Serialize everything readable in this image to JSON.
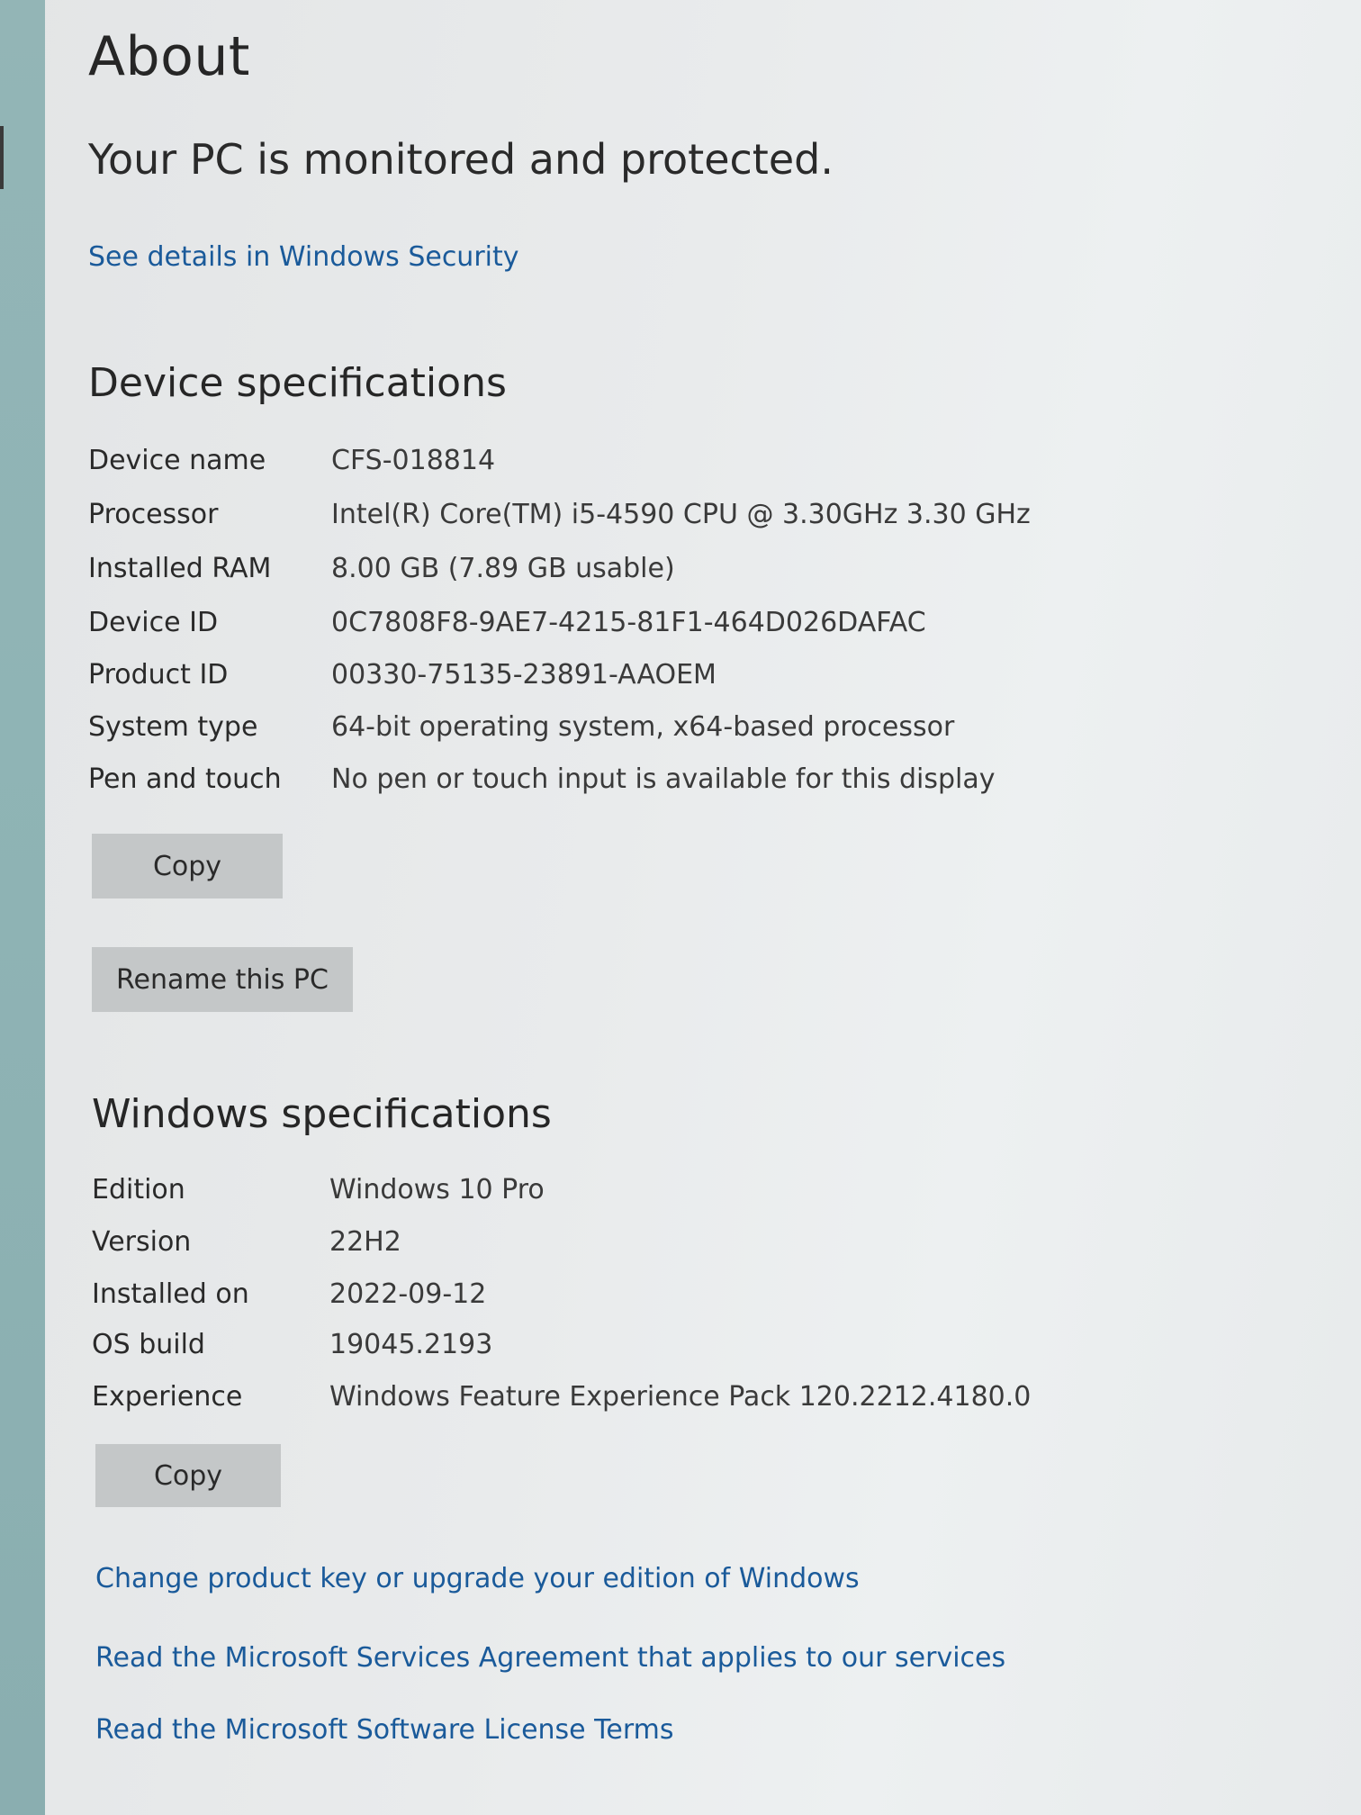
{
  "page": {
    "title": "About"
  },
  "security": {
    "status_text": "Your PC is monitored and protected.",
    "details_link": "See details in Windows Security"
  },
  "device_specs": {
    "title": "Device specifications",
    "rows": [
      {
        "label": "Device name",
        "value": "CFS-018814"
      },
      {
        "label": "Processor",
        "value": "Intel(R) Core(TM) i5-4590 CPU @ 3.30GHz   3.30 GHz"
      },
      {
        "label": "Installed RAM",
        "value": "8.00 GB (7.89 GB usable)"
      },
      {
        "label": "Device ID",
        "value": "0C7808F8-9AE7-4215-81F1-464D026DAFAC"
      },
      {
        "label": "Product ID",
        "value": "00330-75135-23891-AAOEM"
      },
      {
        "label": "System type",
        "value": "64-bit operating system, x64-based processor"
      },
      {
        "label": "Pen and touch",
        "value": "No pen or touch input is available for this display"
      }
    ],
    "copy_label": "Copy",
    "rename_label": "Rename this PC"
  },
  "windows_specs": {
    "title": "Windows specifications",
    "rows": [
      {
        "label": "Edition",
        "value": "Windows 10 Pro"
      },
      {
        "label": "Version",
        "value": "22H2"
      },
      {
        "label": "Installed on",
        "value": "2022-09-12"
      },
      {
        "label": "OS build",
        "value": "19045.2193"
      },
      {
        "label": "Experience",
        "value": "Windows Feature Experience Pack 120.2212.4180.0"
      }
    ],
    "copy_label": "Copy"
  },
  "links": {
    "product_key": "Change product key or upgrade your edition of Windows",
    "services_agreement": "Read the Microsoft Services Agreement that applies to our services",
    "license_terms": "Read the Microsoft Software License Terms"
  },
  "colors": {
    "link": "#1a5a9a",
    "button_bg": "#c4c7c8",
    "sidebar_strip": "#8fb4b5"
  }
}
